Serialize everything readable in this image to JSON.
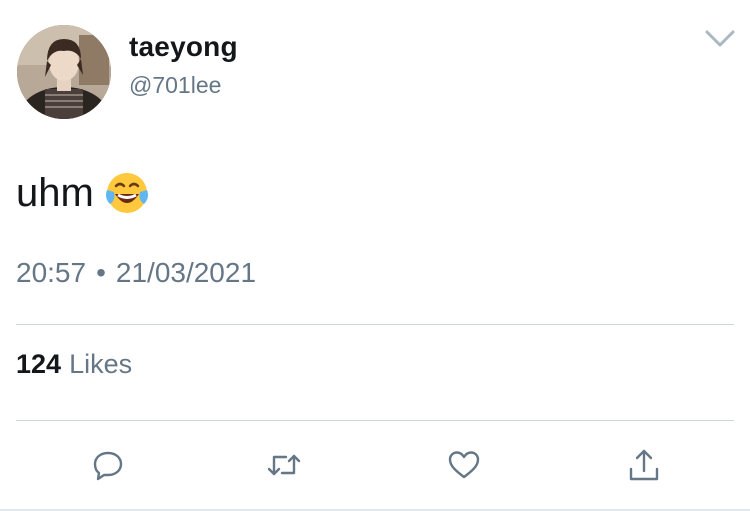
{
  "tweet": {
    "author": {
      "display_name": "taeyong",
      "handle": "@701lee",
      "avatar_icon": "profile-photo"
    },
    "text": "uhm",
    "emoji": "face-with-tears-of-joy",
    "time": "20:57",
    "separator": "•",
    "date": "21/03/2021",
    "likes": {
      "count": "124",
      "label": "Likes"
    },
    "actions": {
      "reply": "reply-icon",
      "retweet": "retweet-icon",
      "like": "heart-icon",
      "share": "share-icon"
    }
  },
  "colors": {
    "primary_text": "#14171a",
    "secondary_text": "#657786",
    "divider": "#ccd6dd",
    "icon": "#657786"
  }
}
